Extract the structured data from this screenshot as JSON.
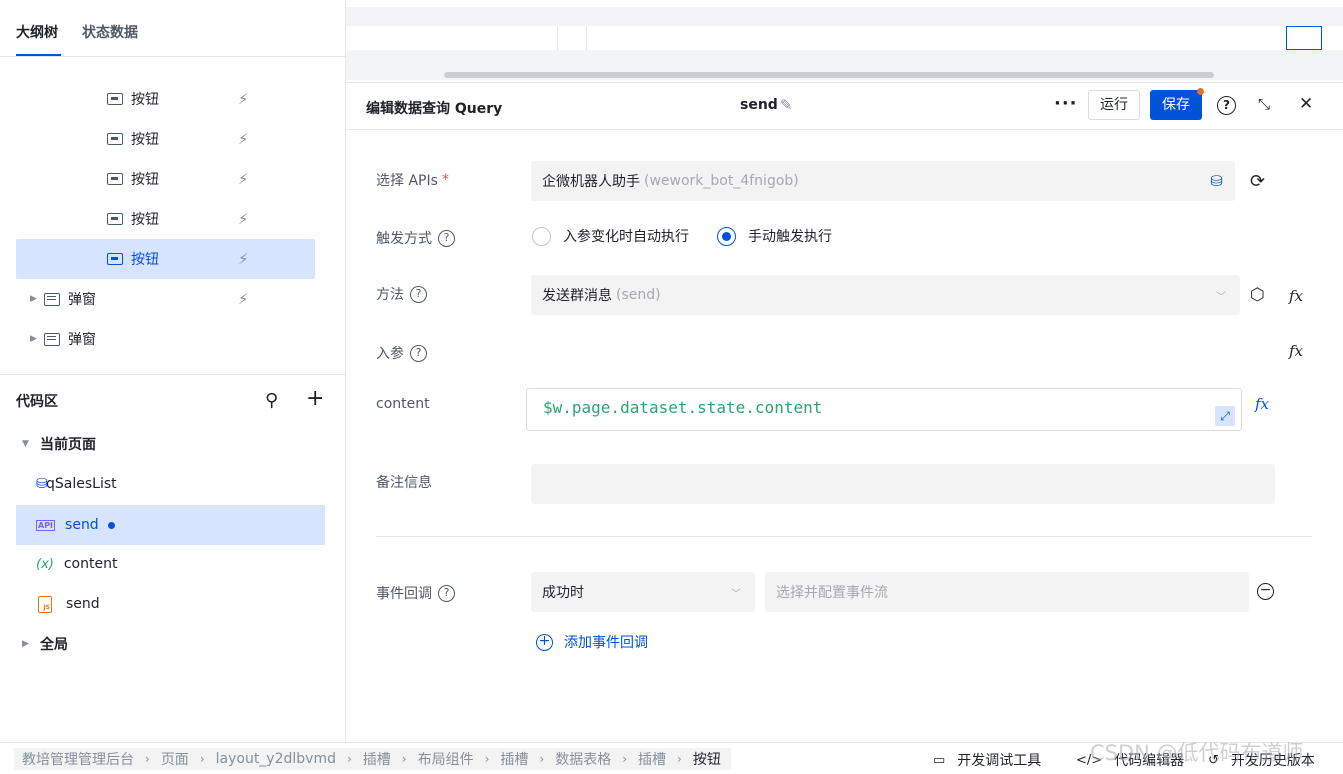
{
  "left_panel": {
    "tabs": [
      {
        "label": "大纲树",
        "active": true
      },
      {
        "label": "状态数据",
        "active": false
      }
    ],
    "outline_items": [
      {
        "label": "按钮",
        "type": "button"
      },
      {
        "label": "按钮",
        "type": "button"
      },
      {
        "label": "按钮",
        "type": "button"
      },
      {
        "label": "按钮",
        "type": "button"
      },
      {
        "label": "按钮",
        "type": "button",
        "selected": true
      },
      {
        "label": "弹窗",
        "type": "dialog"
      },
      {
        "label": "弹窗",
        "type": "dialog"
      }
    ],
    "code_area": {
      "title": "代码区",
      "groups": [
        {
          "label": "当前页面",
          "expanded": true
        },
        {
          "label": "全局",
          "expanded": false
        }
      ],
      "items": [
        {
          "label": "qSalesList",
          "icon": "database-icon"
        },
        {
          "label": "send",
          "icon": "api-icon",
          "selected": true,
          "unsaved": true
        },
        {
          "label": "content",
          "icon": "variable-icon"
        },
        {
          "label": "send",
          "icon": "js-file-icon"
        }
      ]
    }
  },
  "editor": {
    "title": "编辑数据查询 Query",
    "query_name": "send",
    "more": "···",
    "run_label": "运行",
    "save_label": "保存",
    "fields": {
      "api_label": "选择 APIs",
      "api_required": "*",
      "api_value": "企微机器人助手",
      "api_id": "(wework_bot_4fnigob)",
      "trigger_label": "触发方式",
      "trigger_options": [
        {
          "label": "入参变化时自动执行",
          "checked": false
        },
        {
          "label": "手动触发执行",
          "checked": true
        }
      ],
      "method_label": "方法",
      "method_value": "发送群消息",
      "method_id": "(send)",
      "params_label": "入参",
      "content_label": "content",
      "content_value": "$w.page.dataset.state.content",
      "remark_label": "备注信息",
      "remark_value": "",
      "event_label": "事件回调",
      "event_when": "成功时",
      "event_flow_placeholder": "选择并配置事件流",
      "add_event_label": "添加事件回调"
    },
    "fx_label": "fx"
  },
  "footer": {
    "breadcrumbs": [
      "教培管理管理后台",
      "页面",
      "layout_y2dlbvmd",
      "插槽",
      "布局组件",
      "插槽",
      "数据表格",
      "插槽",
      "按钮"
    ],
    "tools": [
      {
        "label": "开发调试工具",
        "icon": "debug-panel-icon"
      },
      {
        "label": "代码编辑器",
        "icon": "code-icon"
      },
      {
        "label": "开发历史版本",
        "icon": "history-icon"
      }
    ],
    "watermark": "CSDN @低代码布道师"
  },
  "colors": {
    "primary": "#0052d9",
    "selected_bg": "#d6e4ff",
    "code_green": "#2ba471",
    "dot_orange": "#e37318"
  }
}
